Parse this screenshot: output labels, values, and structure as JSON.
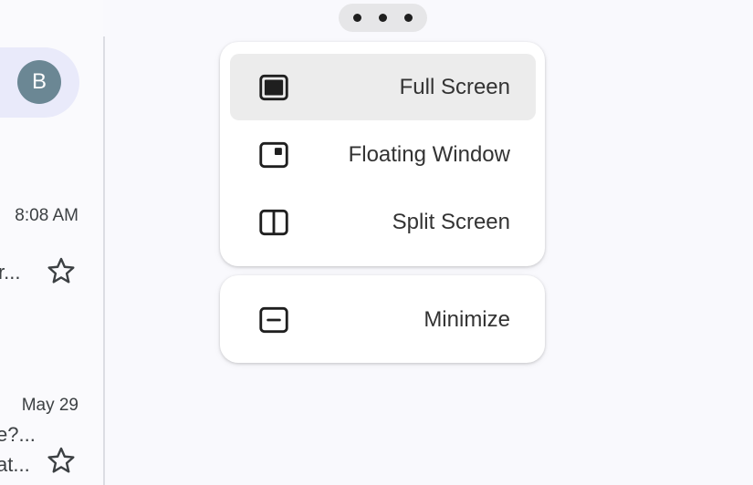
{
  "inbox": {
    "avatar_letter": "B",
    "messages": [
      {
        "time": "8:08 AM",
        "snippet": "r...",
        "starred": false
      },
      {
        "time": "May 29",
        "snippet_1": "e?...",
        "snippet_2": "at...",
        "starred": false
      }
    ]
  },
  "window_menu": {
    "items": [
      {
        "label": "Full Screen",
        "icon": "full-screen-icon",
        "selected": true
      },
      {
        "label": "Floating Window",
        "icon": "floating-window-icon",
        "selected": false
      },
      {
        "label": "Split Screen",
        "icon": "split-screen-icon",
        "selected": false
      }
    ],
    "minimize": {
      "label": "Minimize",
      "icon": "minimize-icon"
    }
  },
  "colors": {
    "background": "#f9f9fd",
    "account_pill": "#e9eafa",
    "avatar": "#6b8794",
    "selected_item": "#ececec",
    "menu_surface": "#ffffff",
    "icon_stroke": "#1f1f1f"
  }
}
